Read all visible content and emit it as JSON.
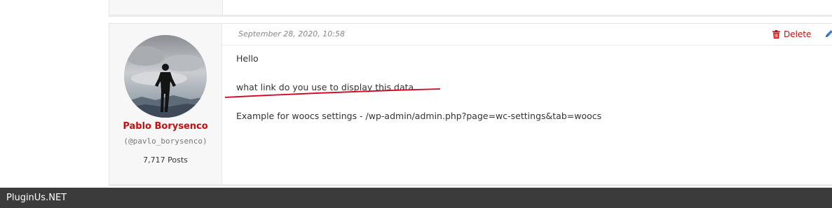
{
  "post": {
    "date": "September 28, 2020, 10:58",
    "delete_label": "Delete",
    "paragraphs": [
      "Hello",
      "what link do you use to display this data",
      "Example  for  woocs  settings - /wp-admin/admin.php?page=wc-settings&tab=woocs"
    ]
  },
  "author": {
    "name": "Pablo Borysenco",
    "handle": "(@pavlo_borysenco)",
    "posts": "7,717 Posts"
  },
  "footer": {
    "brand": "PluginUs.NET"
  },
  "colors": {
    "accent_red": "#c80e0e",
    "footer_bg": "#3b3b3b",
    "annotation_red": "#d8001a"
  },
  "icons": {
    "delete": "trash-icon",
    "edit": "pencil-icon"
  }
}
